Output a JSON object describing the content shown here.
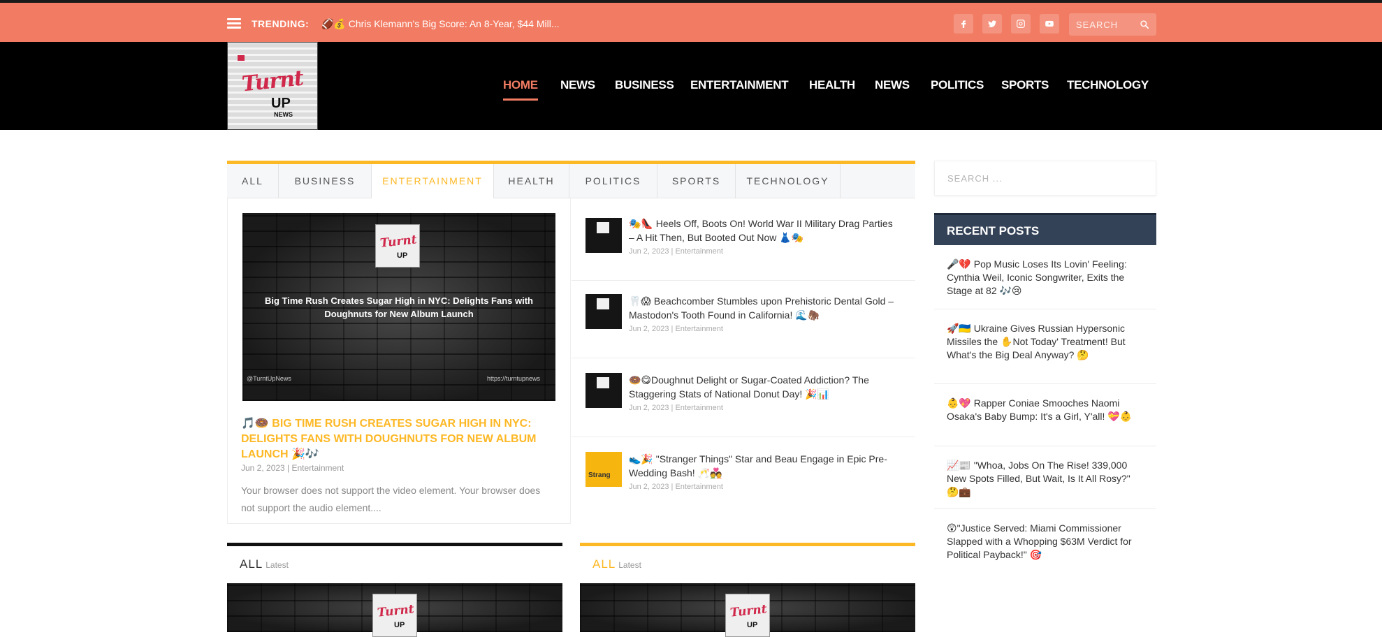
{
  "topbar": {
    "trending_label": "TRENDING:",
    "trending_text": "🏈💰 Chris Klemann's Big Score: An 8-Year, $44 Mill...",
    "search_placeholder": "SEARCH",
    "social": [
      "facebook-icon",
      "twitter-icon",
      "instagram-icon",
      "youtube-icon"
    ]
  },
  "logo": {
    "word": "Turnt",
    "up": "UP",
    "news": "NEWS"
  },
  "nav": {
    "items": [
      "HOME",
      "NEWS",
      "BUSINESS",
      "ENTERTAINMENT",
      "HEALTH",
      "NEWS",
      "POLITICS",
      "SPORTS",
      "TECHNOLOGY"
    ],
    "active_index": 0
  },
  "tabs": {
    "items": [
      "ALL",
      "BUSINESS",
      "ENTERTAINMENT",
      "HEALTH",
      "POLITICS",
      "SPORTS",
      "TECHNOLOGY"
    ],
    "active_index": 2
  },
  "featured": {
    "video_caption": "Big Time Rush Creates Sugar High in NYC: Delights Fans with Doughnuts for New Album Launch",
    "corner_left": "@TurntUpNews",
    "corner_right": "https://turntupnews",
    "logo_word": "Turnt",
    "logo_up": "UP",
    "title": "🎵🍩 BIG TIME RUSH CREATES SUGAR HIGH IN NYC: DELIGHTS FANS WITH DOUGHNUTS FOR NEW ALBUM LAUNCH 🎉🎶",
    "meta": "Jun 2, 2023 | Entertainment",
    "excerpt": "Your browser does not support the video element. Your browser does not support the audio element...."
  },
  "articles": [
    {
      "title": "🎭👠 Heels Off, Boots On! World War II Military Drag Parties – A Hit Then, But Booted Out Now 👗🎭",
      "meta": "Jun 2, 2023 | Entertainment"
    },
    {
      "title": "🦷😱 Beachcomber Stumbles upon Prehistoric Dental Gold – Mastodon's Tooth Found in California! 🌊🦣",
      "meta": "Jun 2, 2023 | Entertainment"
    },
    {
      "title": "🍩😋Doughnut Delight or Sugar-Coated Addiction? The Staggering Stats of National Donut Day! 🎉📊",
      "meta": "Jun 2, 2023 | Entertainment"
    },
    {
      "title": "👟🎉 \"Stranger Things\" Star and Beau Engage in Epic Pre-Wedding Bash! 🥂💑",
      "meta": "Jun 2, 2023 | Entertainment",
      "thumb_text": "Strang"
    }
  ],
  "bottom_blocks": [
    {
      "head": "ALL",
      "sub": "Latest"
    },
    {
      "head": "ALL",
      "sub": "Latest"
    }
  ],
  "sidebar": {
    "search_placeholder": "SEARCH ...",
    "recent_heading": "RECENT POSTS",
    "recent_posts": [
      "🎤💔 Pop Music Loses Its Lovin' Feeling: Cynthia Weil, Iconic Songwriter, Exits the Stage at 82 🎶😢",
      "🚀🇺🇦 Ukraine Gives Russian Hypersonic Missiles the ✋Not Today' Treatment! But What's the Big Deal Anyway? 🤔",
      "👶💖 Rapper Coniae Smooches Naomi Osaka's Baby Bump: It's a Girl, Y'all! 💝👶",
      "📈📰 \"Whoa, Jobs On The Rise! 339,000 New Spots Filled, But Wait, Is It All Rosy?\" 🤔💼",
      "😲\"Justice Served: Miami Commissioner Slapped with a Whopping $63M Verdict for Political Payback!\" 🎯"
    ]
  },
  "colors": {
    "topbar": "#f27c63",
    "accent_yellow": "#fdb825",
    "sidebar_head": "#344257"
  }
}
